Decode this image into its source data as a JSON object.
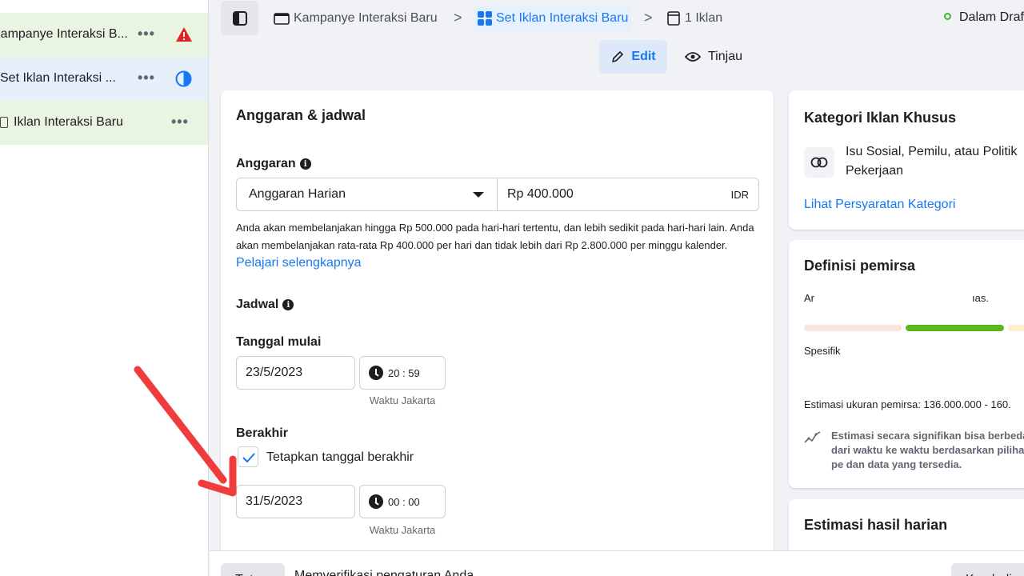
{
  "sidebar": {
    "items": [
      {
        "label": "Kampanye Interaksi B...",
        "menu": "•••",
        "status_icon": "warning-icon"
      },
      {
        "label": "Set Iklan Interaksi ...",
        "menu": "•••",
        "status_icon": "half-circle-icon"
      },
      {
        "label": "Iklan Interaksi Baru",
        "menu": "•••",
        "status_icon": "document-icon"
      }
    ]
  },
  "breadcrumb": {
    "campaign": "Kampanye Interaksi Baru",
    "adset": "Set Iklan Interaksi Baru",
    "ads": "1 Iklan",
    "separator": ">"
  },
  "status": {
    "label": "Dalam Draf",
    "color": "#42b72a"
  },
  "mode": {
    "edit": "Edit",
    "review": "Tinjau"
  },
  "budget_schedule": {
    "title": "Anggaran & jadwal",
    "budget_label": "Anggaran",
    "budget_type": "Anggaran Harian",
    "amount": "Rp 400.000",
    "currency": "IDR",
    "description": "Anda akan membelanjakan hingga Rp 500.000 pada hari-hari tertentu, dan lebih sedikit pada hari-hari lain. Anda akan membelanjakan rata-rata Rp 400.000 per hari dan tidak lebih dari Rp 2.800.000 per minggu kalender.",
    "learn_more": "Pelajari selengkapnya",
    "schedule_label": "Jadwal",
    "start_label": "Tanggal mulai",
    "start_date": "23/5/2023",
    "start_time": "20 : 59",
    "timezone": "Waktu Jakarta",
    "end_label": "Berakhir",
    "end_checkbox_label": "Tetapkan tanggal berakhir",
    "end_checked": true,
    "end_date": "31/5/2023",
    "end_time": "00 : 00"
  },
  "special_category": {
    "title": "Kategori Iklan Khusus",
    "line1": "Isu Sosial, Pemilu, atau Politik",
    "line2": "Pekerjaan",
    "link": "Lihat Persyaratan Kategori"
  },
  "audience": {
    "title": "Definisi pemirsa",
    "line": "Ar",
    "line_end": "ıas.",
    "specific": "Spesifik",
    "estimate": "Estimasi ukuran pemirsa: 136.000.000 - 160.",
    "note": "Estimasi secara signifikan bisa berbeda dari waktu ke waktu berdasarkan pilihan pe dan data yang tersedia."
  },
  "daily_results": {
    "title": "Estimasi hasil harian"
  },
  "footer": {
    "close": "Tutup",
    "verify": "Memverifikasi pengaturan Anda...",
    "back": "Kembali"
  },
  "colors": {
    "accent": "#1877f2",
    "arrow": "#f03c3c"
  }
}
